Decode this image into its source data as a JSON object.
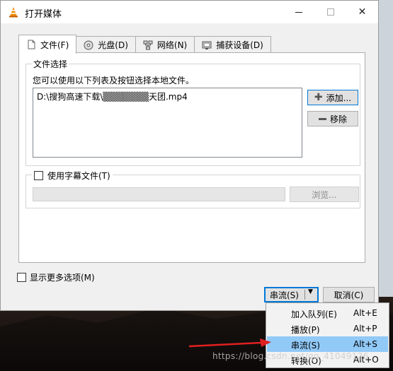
{
  "window": {
    "title": "打开媒体"
  },
  "tabs": [
    {
      "label": "文件(F)",
      "icon": "file-icon"
    },
    {
      "label": "光盘(D)",
      "icon": "disc-icon"
    },
    {
      "label": "网络(N)",
      "icon": "network-icon"
    },
    {
      "label": "捕获设备(D)",
      "icon": "capture-icon"
    }
  ],
  "file_group": {
    "label": "文件选择",
    "hint": "您可以使用以下列表及按钮选择本地文件。",
    "files": [
      "D:\\搜狗高速下载\\▒▒▒▒▒▒▒天团.mp4"
    ],
    "add_label": "添加...",
    "remove_label": "移除"
  },
  "subtitle_group": {
    "checkbox_label": "使用字幕文件(T)",
    "browse_label": "浏览..."
  },
  "more_options_label": "显示更多选项(M)",
  "footer": {
    "stream_label": "串流(S)",
    "cancel_label": "取消(C)"
  },
  "dropdown": {
    "items": [
      {
        "label": "加入队列(E)",
        "shortcut": "Alt+E"
      },
      {
        "label": "播放(P)",
        "shortcut": "Alt+P"
      },
      {
        "label": "串流(S)",
        "shortcut": "Alt+S",
        "highlighted": true
      },
      {
        "label": "转换(O)",
        "shortcut": "Alt+O"
      }
    ]
  },
  "watermark": "https://blog.csdn.net/qq_41049126",
  "colors": {
    "accent": "#0078d7",
    "highlight": "#91c9f7",
    "annotation_arrow": "#e02020"
  }
}
